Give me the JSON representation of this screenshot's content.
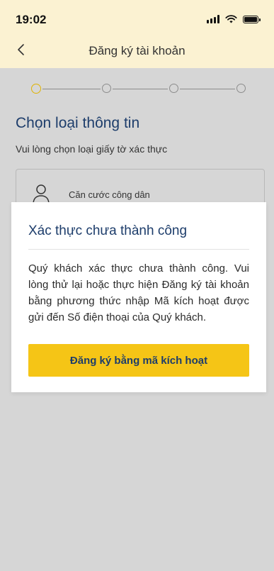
{
  "status_bar": {
    "time": "19:02"
  },
  "header": {
    "title": "Đăng ký tài khoản"
  },
  "stepper": {
    "total_steps": 4,
    "current_step": 1
  },
  "page": {
    "title": "Chọn loại thông tin",
    "subtitle": "Vui lòng chọn loại giấy tờ xác thực"
  },
  "options": [
    {
      "label": "Căn cước công dân",
      "icon": "person-icon"
    }
  ],
  "dialog": {
    "title": "Xác thực chưa thành công",
    "message": "Quý khách xác thực chưa thành công. Vui lòng thử lại hoặc thực hiện Đăng ký tài khoản bằng phương thức nhập Mã kích hoạt được gửi đến Số điện thoại của Quý khách.",
    "button_label": "Đăng ký bằng mã kích hoạt"
  },
  "colors": {
    "header_bg": "#fbf2d2",
    "overlay_bg": "#d6d6d6",
    "accent_yellow": "#f5c516",
    "title_blue": "#1d3d6b"
  }
}
